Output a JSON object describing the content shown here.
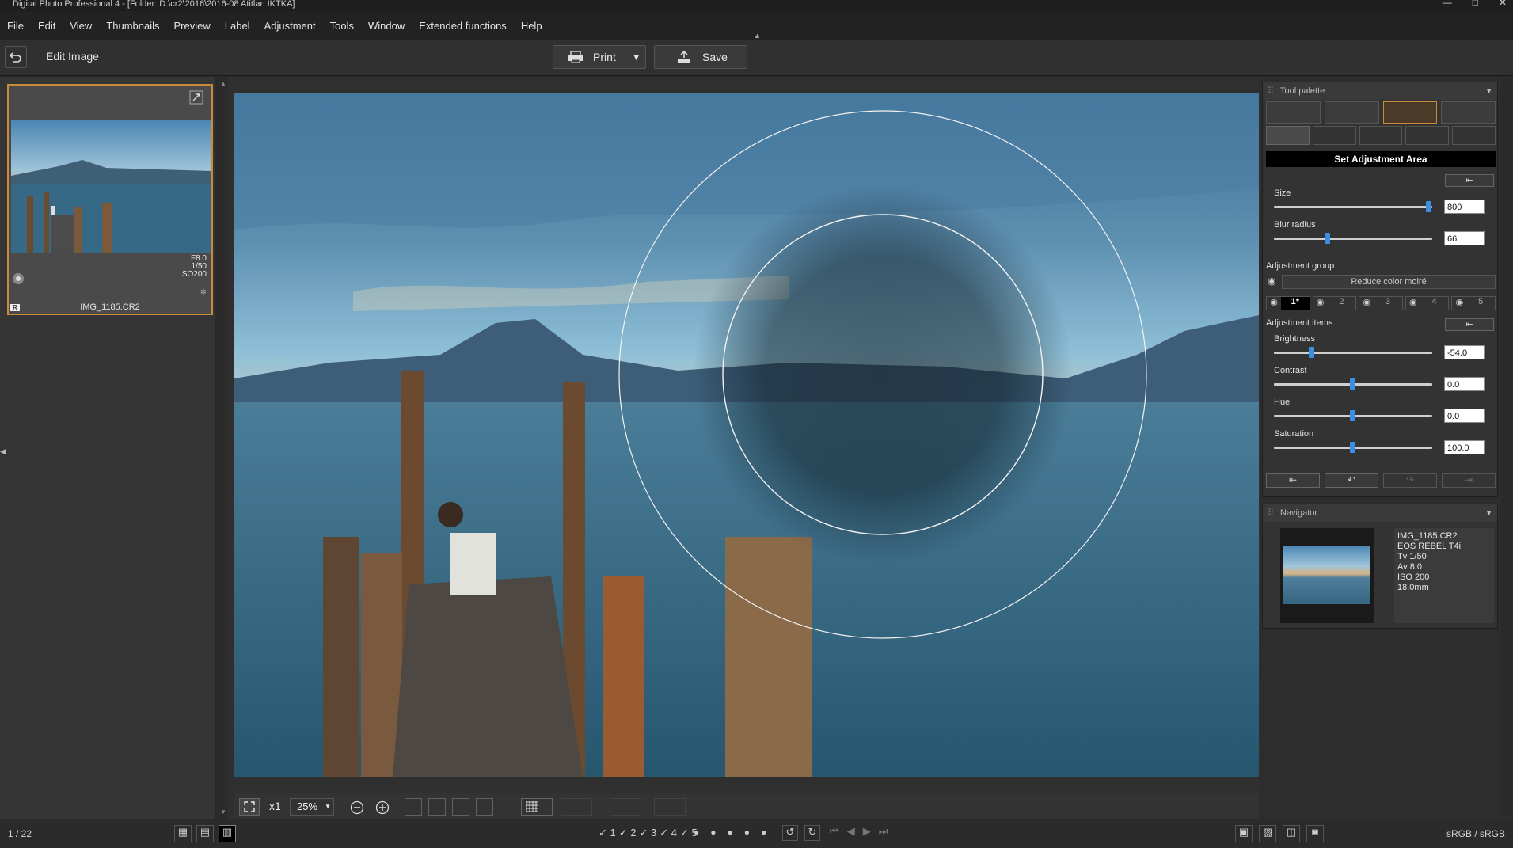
{
  "window": {
    "title": "Digital Photo Professional 4 - [Folder: D:\\cr2\\2016\\2016-08 Atitlan IKTKA]",
    "controls": [
      "—",
      "□",
      "✕"
    ]
  },
  "menu": [
    "File",
    "Edit",
    "View",
    "Thumbnails",
    "Preview",
    "Label",
    "Adjustment",
    "Tools",
    "Window",
    "Extended functions",
    "Help"
  ],
  "toolbar": {
    "mode_label": "Edit Image",
    "print_label": "Print",
    "save_label": "Save"
  },
  "thumbnail": {
    "exif": [
      "F8.0",
      "1/50",
      "ISO200"
    ],
    "filename": "IMG_1185.CR2",
    "badge": "R"
  },
  "status": {
    "counter": "1 / 22",
    "color_space": "sRGB / sRGB",
    "check_marks": [
      "✓ 1",
      "✓ 2",
      "✓ 3",
      "✓ 4",
      "✓ 5"
    ]
  },
  "viewbar": {
    "zoom_mult": "x1",
    "zoom": "25%"
  },
  "palette": {
    "title": "Tool palette",
    "section_title": "Set Adjustment Area",
    "size_label": "Size",
    "size_value": "800",
    "size_fraction": 0.98,
    "blur_label": "Blur radius",
    "blur_value": "66",
    "blur_fraction": 0.34,
    "group_label": "Adjustment group",
    "moire_label": "Reduce color moiré",
    "groups": [
      "1*",
      "2",
      "3",
      "4",
      "5"
    ],
    "items_label": "Adjustment items",
    "brightness_label": "Brightness",
    "brightness_value": "-54.0",
    "brightness_fraction": 0.24,
    "contrast_label": "Contrast",
    "contrast_value": "0.0",
    "contrast_fraction": 0.5,
    "hue_label": "Hue",
    "hue_value": "0.0",
    "hue_fraction": 0.5,
    "saturation_label": "Saturation",
    "saturation_value": "100.0",
    "saturation_fraction": 0.5
  },
  "navigator": {
    "title": "Navigator",
    "info": [
      "IMG_1185.CR2",
      "EOS REBEL T4i",
      "Tv 1/50",
      "Av 8.0",
      "ISO 200",
      "18.0mm"
    ]
  },
  "colors": {
    "accent": "#c98a3a",
    "slider_knob": "#3b8fe0",
    "section_bg": "#000000"
  }
}
